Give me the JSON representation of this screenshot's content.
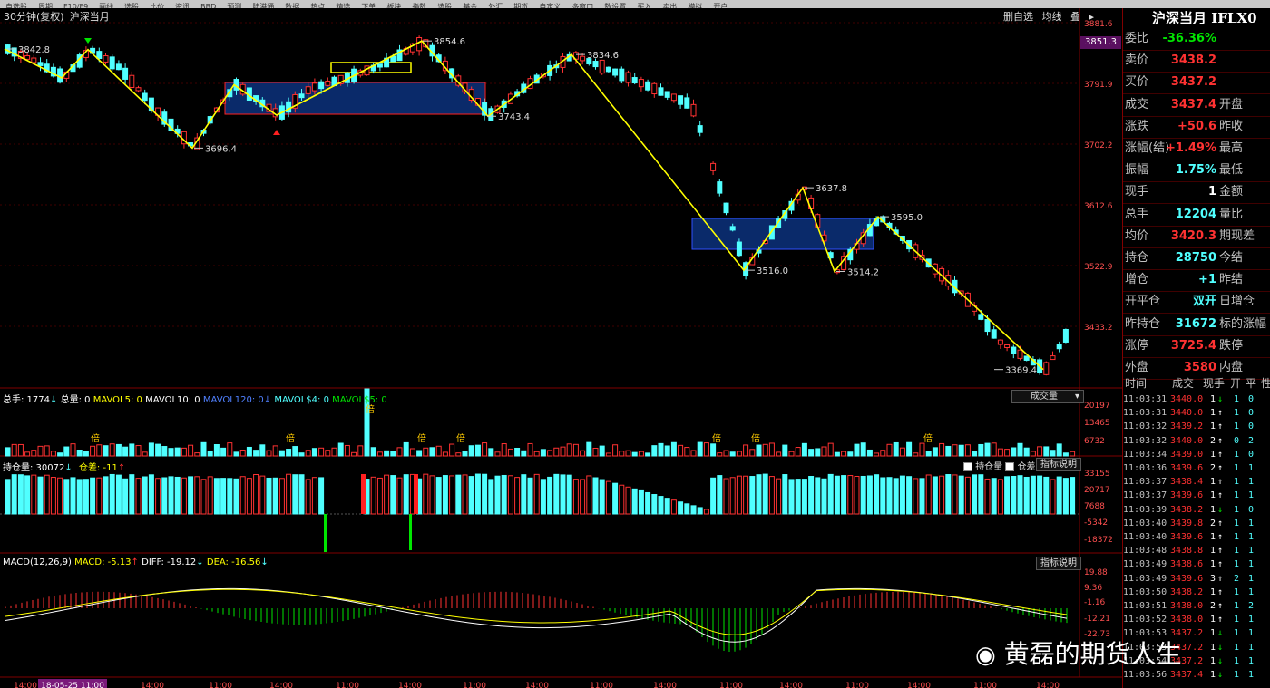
{
  "toolbar": {
    "items": [
      "自选股",
      "周期",
      "F10/F9",
      "画线",
      "选股",
      "比价",
      "资讯",
      "BBD",
      "预测",
      "陆港通",
      "数据",
      "热点",
      "精选",
      "下单",
      "板块",
      "指数",
      "选股",
      "基金",
      "外汇",
      "期货",
      "自定义",
      "多窗口",
      "数设置",
      "买入",
      "卖出",
      "模拟",
      "开户"
    ]
  },
  "chart": {
    "period_label": "30分钟(复权)",
    "symbol": "沪深当月",
    "buttons": [
      "删自选",
      "均线",
      "叠"
    ],
    "price_axis": [
      "3881.6",
      "3851.3",
      "3791.9",
      "3702.2",
      "3612.6",
      "3522.9",
      "3433.2"
    ],
    "swing_labels": [
      "3842.8",
      "3854.6",
      "3834.6",
      "3696.4",
      "3743.4",
      "3637.8",
      "3595.0",
      "3516.0",
      "3514.2",
      "3369.4"
    ],
    "time_axis": [
      "14:00",
      "18-05-25 11:00",
      "14:00",
      "11:00",
      "14:00",
      "11:00",
      "14:00",
      "11:00",
      "14:00",
      "11:00",
      "14:00",
      "11:00",
      "14:00",
      "11:00",
      "14:00",
      "11:00",
      "14:00"
    ]
  },
  "volume": {
    "label_total": "总手: 1774",
    "label_vol": "总量: 0",
    "label_ma5": "MAVOL5: 0",
    "label_ma10": "MAVOL10: 0",
    "label_ma120": "MAVOL120: 0",
    "label_s4": "MAVOL$4: 0",
    "label_s5": "MAVOL$5: 0",
    "dropdown": "成交量",
    "axis": [
      "20197",
      "13465",
      "6732"
    ],
    "marks": [
      "倍",
      "倍",
      "倍",
      "倍",
      "倍",
      "倍",
      "倍",
      "倍"
    ]
  },
  "open_interest": {
    "label": "持仓量: 30072",
    "diff_label": "仓差: -11",
    "check1": "持仓量",
    "check2": "仓差",
    "help": "指标说明",
    "axis": [
      "33155",
      "20717",
      "7688",
      "-5342",
      "-18372"
    ]
  },
  "macd": {
    "label": "MACD(12,26,9)",
    "macd": "MACD: -5.13",
    "diff": "DIFF: -19.12",
    "dea": "DEA: -16.56",
    "help": "指标说明",
    "axis": [
      "19.88",
      "9.36",
      "-1.16",
      "-12.21",
      "-22.73"
    ]
  },
  "quote": {
    "title": "沪深当月 IFLX0",
    "rows": [
      {
        "label": "委比",
        "value": "-36.36%",
        "color": "green"
      },
      {
        "label": "卖价",
        "value": "3438.2",
        "color": "red"
      },
      {
        "label": "买价",
        "value": "3437.2",
        "color": "red"
      },
      {
        "label": "成交",
        "value": "3437.4",
        "color": "red",
        "label2": "开盘"
      },
      {
        "label": "涨跌",
        "value": "+50.6",
        "color": "red",
        "label2": "昨收"
      },
      {
        "label": "涨幅(结)",
        "value": "+1.49%",
        "color": "red",
        "label2": "最高"
      },
      {
        "label": "振幅",
        "value": "1.75%",
        "color": "cyan",
        "label2": "最低"
      },
      {
        "label": "现手",
        "value": "1",
        "color": "white",
        "label2": "金额"
      },
      {
        "label": "总手",
        "value": "12204",
        "color": "cyan",
        "label2": "量比"
      },
      {
        "label": "均价",
        "value": "3420.3",
        "color": "red",
        "label2": "期现差"
      },
      {
        "label": "持仓",
        "value": "28750",
        "color": "cyan",
        "label2": "今结"
      },
      {
        "label": "增仓",
        "value": "+1",
        "color": "cyan",
        "label2": "昨结"
      },
      {
        "label": "开平仓",
        "value": "双开",
        "color": "cyan",
        "label2": "日增仓"
      },
      {
        "label": "昨持仓",
        "value": "31672",
        "color": "cyan",
        "label2": "标的涨幅"
      },
      {
        "label": "涨停",
        "value": "3725.4",
        "color": "red",
        "label2": "跌停"
      },
      {
        "label": "外盘",
        "value": "3580",
        "color": "red",
        "label2": "内盘"
      }
    ],
    "tick_header": [
      "时间",
      "成交",
      "现手",
      "开",
      "平",
      "性"
    ],
    "ticks": [
      [
        "11:03:31",
        "3440.0",
        "1",
        "↓",
        "1",
        "0"
      ],
      [
        "11:03:31",
        "3440.0",
        "1",
        "↑",
        "1",
        "0"
      ],
      [
        "11:03:32",
        "3439.2",
        "1",
        "↑",
        "1",
        "0"
      ],
      [
        "11:03:32",
        "3440.0",
        "2",
        "↑",
        "0",
        "2"
      ],
      [
        "11:03:34",
        "3439.0",
        "1",
        "↑",
        "1",
        "0"
      ],
      [
        "11:03:36",
        "3439.6",
        "2",
        "↑",
        "1",
        "1"
      ],
      [
        "11:03:37",
        "3438.4",
        "1",
        "↑",
        "1",
        "1"
      ],
      [
        "11:03:37",
        "3439.6",
        "1",
        "↑",
        "1",
        "1"
      ],
      [
        "11:03:39",
        "3438.2",
        "1",
        "↓",
        "1",
        "0"
      ],
      [
        "11:03:40",
        "3439.8",
        "2",
        "↑",
        "1",
        "1"
      ],
      [
        "11:03:40",
        "3439.6",
        "1",
        "↑",
        "1",
        "1"
      ],
      [
        "11:03:48",
        "3438.8",
        "1",
        "↑",
        "1",
        "1"
      ],
      [
        "11:03:49",
        "3438.6",
        "1",
        "↑",
        "1",
        "1"
      ],
      [
        "11:03:49",
        "3439.6",
        "3",
        "↑",
        "2",
        "1"
      ],
      [
        "11:03:50",
        "3438.2",
        "1",
        "↑",
        "1",
        "1"
      ],
      [
        "11:03:51",
        "3438.0",
        "2",
        "↑",
        "1",
        "2"
      ],
      [
        "11:03:52",
        "3438.0",
        "1",
        "↑",
        "1",
        "1"
      ],
      [
        "11:03:53",
        "3437.2",
        "1",
        "↓",
        "1",
        "1"
      ],
      [
        "11:03:53",
        "3437.2",
        "1",
        "↓",
        "1",
        "1"
      ],
      [
        "11:03:54",
        "3437.2",
        "1",
        "↓",
        "1",
        "1"
      ],
      [
        "11:03:56",
        "3437.4",
        "1",
        "↓",
        "1",
        "1"
      ]
    ]
  },
  "watermark": {
    "text": "黄磊的期货人生"
  },
  "colors": {
    "up": "#ff3232",
    "down": "#50ffff",
    "trend": "#ffff00",
    "box_fill": "#0a2a6a",
    "box_border": "#ff2020"
  }
}
